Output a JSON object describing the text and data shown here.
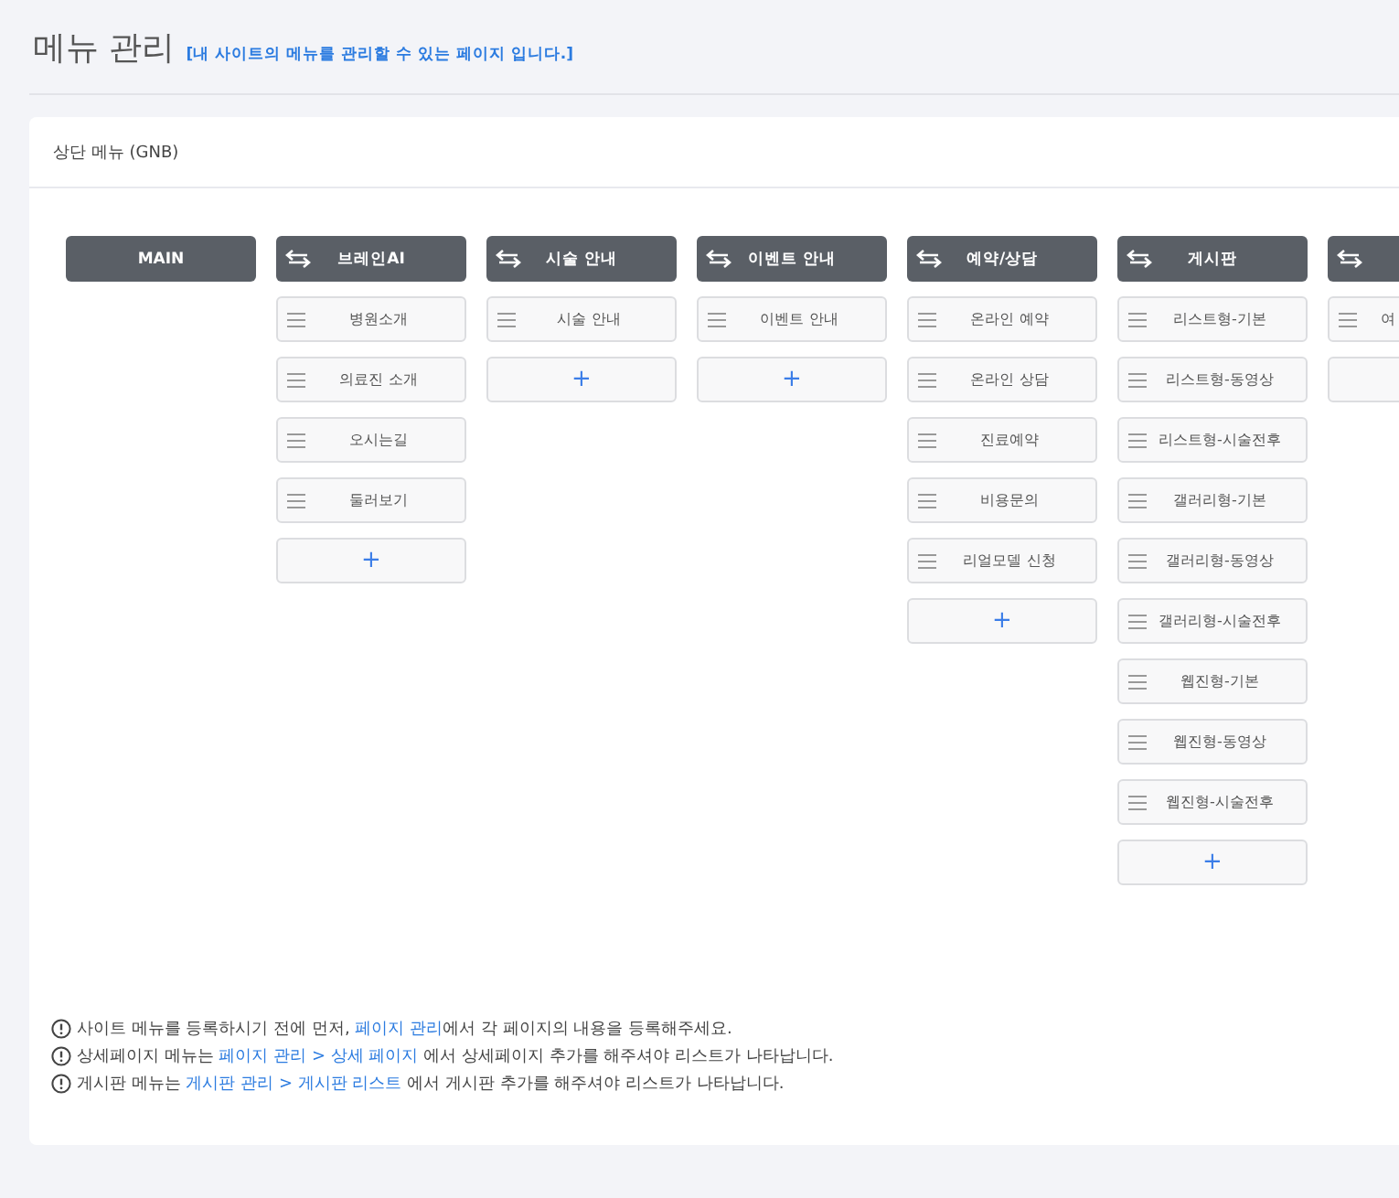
{
  "page": {
    "title": "메뉴 관리",
    "subtitle": "[내 사이트의 메뉴를 관리할 수 있는 페이지 입니다.]"
  },
  "panel": {
    "title": "상단 메뉴 (GNB)"
  },
  "columns": [
    {
      "kind": "main",
      "title": "MAIN"
    },
    {
      "kind": "menu",
      "title": "브레인AI",
      "items": [
        "병원소개",
        "의료진 소개",
        "오시는길",
        "둘러보기"
      ],
      "add_button": "+"
    },
    {
      "kind": "menu",
      "title": "시술 안내",
      "items": [
        "시술 안내"
      ],
      "add_button": "+"
    },
    {
      "kind": "menu",
      "title": "이벤트 안내",
      "items": [
        "이벤트 안내"
      ],
      "add_button": "+"
    },
    {
      "kind": "menu",
      "title": "예약/상담",
      "items": [
        "온라인 예약",
        "온라인 상담",
        "진료예약",
        "비용문의",
        "리얼모델 신청"
      ],
      "add_button": "+"
    },
    {
      "kind": "menu",
      "title": "게시판",
      "items": [
        "리스트형-기본",
        "리스트형-동영상",
        "리스트형-시술전후",
        "갤러리형-기본",
        "갤러리형-동영상",
        "갤러리형-시술전후",
        "웹진형-기본",
        "웹진형-동영상",
        "웹진형-시술전후"
      ],
      "add_button": "+"
    },
    {
      "kind": "cut",
      "items": [
        "여"
      ]
    }
  ],
  "notes": [
    [
      {
        "text": "사이트 메뉴를 등록하시기 전에 먼저, ",
        "link": false
      },
      {
        "text": "페이지 관리",
        "link": true
      },
      {
        "text": "에서 각 페이지의 내용을 등록해주세요.",
        "link": false
      }
    ],
    [
      {
        "text": "상세페이지 메뉴는 ",
        "link": false
      },
      {
        "text": "페이지 관리 > 상세 페이지",
        "link": true
      },
      {
        "text": " 에서 상세페이지 추가를 해주셔야 리스트가 나타납니다.",
        "link": false
      }
    ],
    [
      {
        "text": "게시판 메뉴는 ",
        "link": false
      },
      {
        "text": "게시판 관리 > 게시판 리스트",
        "link": true
      },
      {
        "text": " 에서 게시판 추가를 해주셔야 리스트가 나타납니다.",
        "link": false
      }
    ]
  ]
}
